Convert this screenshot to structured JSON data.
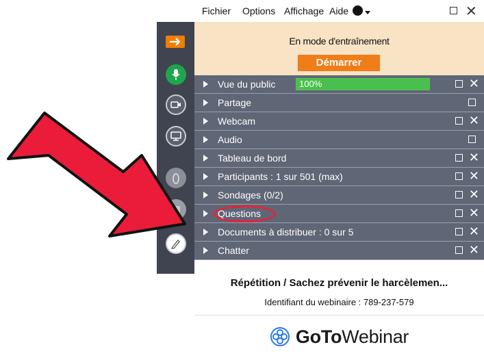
{
  "menu": {
    "items": [
      "Fichier",
      "Options",
      "Affichage",
      "Aide"
    ]
  },
  "practice": {
    "mode_text": "En mode d'entraînement",
    "start_label": "Démarrer"
  },
  "panes": [
    {
      "label": "Vue du public",
      "progress_text": "100%",
      "progress": 100
    },
    {
      "label": "Partage"
    },
    {
      "label": "Webcam"
    },
    {
      "label": "Audio"
    },
    {
      "label": "Tableau de bord"
    },
    {
      "label": "Participants :  1 sur 501 (max)"
    },
    {
      "label": "Sondages (0/2)"
    },
    {
      "label": "Questions"
    },
    {
      "label": "Documents à distribuer : 0 sur 5"
    },
    {
      "label": "Chatter"
    }
  ],
  "session": {
    "title": "Répétition / Sachez prévenir le harcèlemen...",
    "webinar_id": "Identifiant du webinaire : 789-237-579"
  },
  "logo": {
    "bold": "GoTo",
    "rest": "Webinar"
  },
  "colors": {
    "accent_orange": "#ef7d19",
    "pane_bg": "#5f6676",
    "toolbar_bg": "#3f4450",
    "highlight_red": "#e5233a"
  },
  "icons": {
    "toolbar": [
      "arrow-right-icon",
      "microphone-icon",
      "camera-icon",
      "screen-share-icon",
      "raise-hand-icon",
      "poll-icon",
      "pen-icon"
    ]
  }
}
